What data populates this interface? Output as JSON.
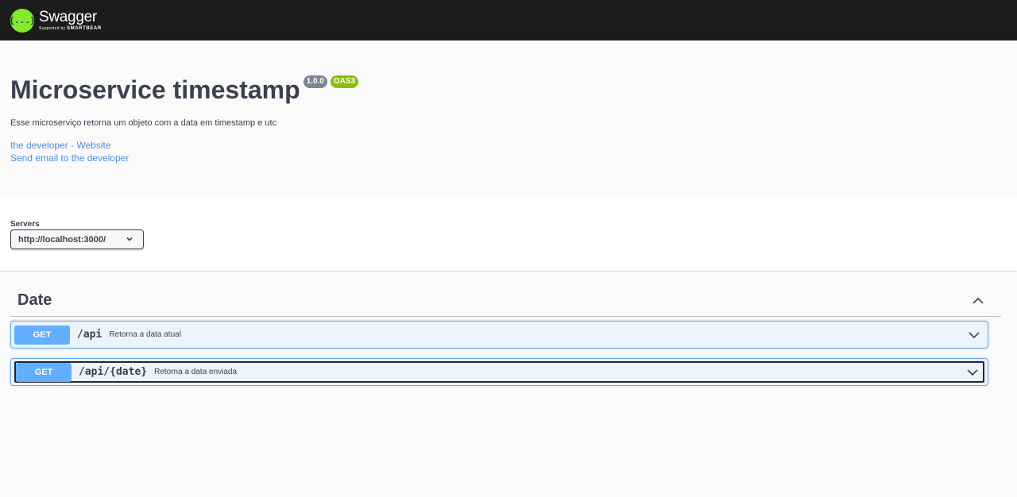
{
  "topbar": {
    "logo_icon": "{...}",
    "logo_name": "Swagger",
    "logo_sub_prefix": "Supported by",
    "logo_sub_brand": "SMARTBEAR"
  },
  "info": {
    "title": "Microservice timestamp",
    "version": "1.0.0",
    "oas": "OAS3",
    "description": "Esse microserviço retorna um objeto com a data em timestamp e utc",
    "links": [
      "the developer - Website",
      "Send email to the developer"
    ]
  },
  "servers": {
    "label": "Servers",
    "selected": "http://localhost:3000/"
  },
  "tag": {
    "name": "Date",
    "operations": [
      {
        "method": "GET",
        "path": "/api",
        "summary": "Retorna a data atual"
      },
      {
        "method": "GET",
        "path": "/api/{date}",
        "summary": "Retorna a data enviada"
      }
    ]
  },
  "colors": {
    "topbar": "#1b1b1b",
    "logo_green": "#85ea2d",
    "get_blue": "#61affe",
    "get_bg": "#ebf3fb",
    "link": "#4990e2",
    "version_badge": "#7d8492",
    "oas_badge": "#89bf04"
  },
  "icons": {
    "server_dropdown": "chevron-down-icon",
    "tag_toggle": "chevron-up-icon",
    "operation_toggle": "chevron-down-icon"
  }
}
